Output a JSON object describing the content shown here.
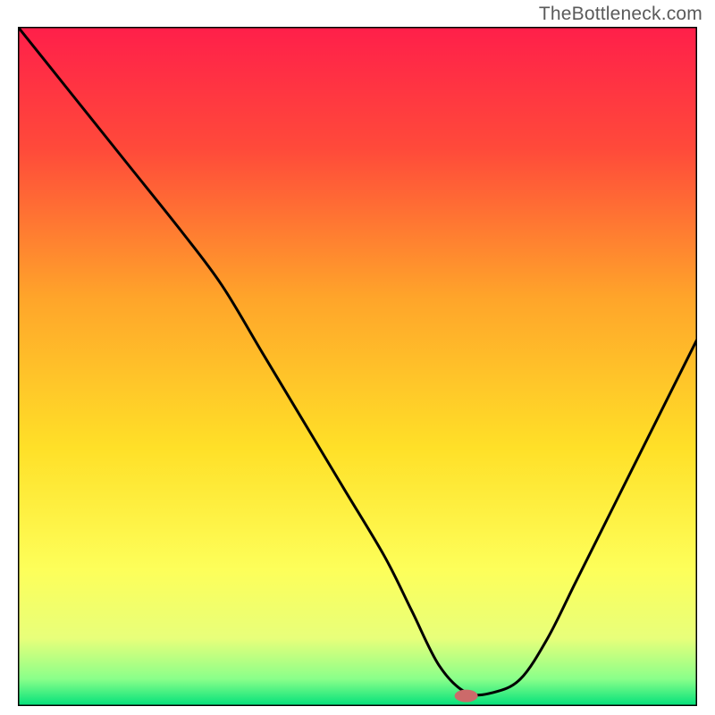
{
  "watermark": "TheBottleneck.com",
  "chart_data": {
    "type": "line",
    "title": "",
    "xlabel": "",
    "ylabel": "",
    "xlim": [
      0,
      100
    ],
    "ylim": [
      0,
      100
    ],
    "grid": false,
    "legend": false,
    "background_gradient_vertical": {
      "stops": [
        {
          "pos": 0.0,
          "color": "#ff1f4a"
        },
        {
          "pos": 0.18,
          "color": "#ff4a3a"
        },
        {
          "pos": 0.4,
          "color": "#ffa52a"
        },
        {
          "pos": 0.62,
          "color": "#ffe028"
        },
        {
          "pos": 0.8,
          "color": "#fdff5a"
        },
        {
          "pos": 0.9,
          "color": "#e8ff7a"
        },
        {
          "pos": 0.96,
          "color": "#8aff8a"
        },
        {
          "pos": 1.0,
          "color": "#00e07a"
        }
      ]
    },
    "series": [
      {
        "name": "bottleneck-curve",
        "x": [
          0,
          8,
          16,
          24,
          30,
          36,
          42,
          48,
          54,
          58,
          62,
          66,
          70,
          74,
          78,
          82,
          86,
          90,
          94,
          100
        ],
        "y": [
          100,
          90,
          80,
          70,
          62,
          52,
          42,
          32,
          22,
          14,
          6,
          2,
          2,
          4,
          10,
          18,
          26,
          34,
          42,
          54
        ]
      }
    ],
    "marker": {
      "name": "optimal-point",
      "x": 66,
      "y": 1.5,
      "color": "#cc6a6a",
      "rx": 13,
      "ry": 7
    },
    "baseline": {
      "y": 0,
      "color": "#000000"
    },
    "frame_stroke": "#000000",
    "frame_stroke_width": 3
  }
}
